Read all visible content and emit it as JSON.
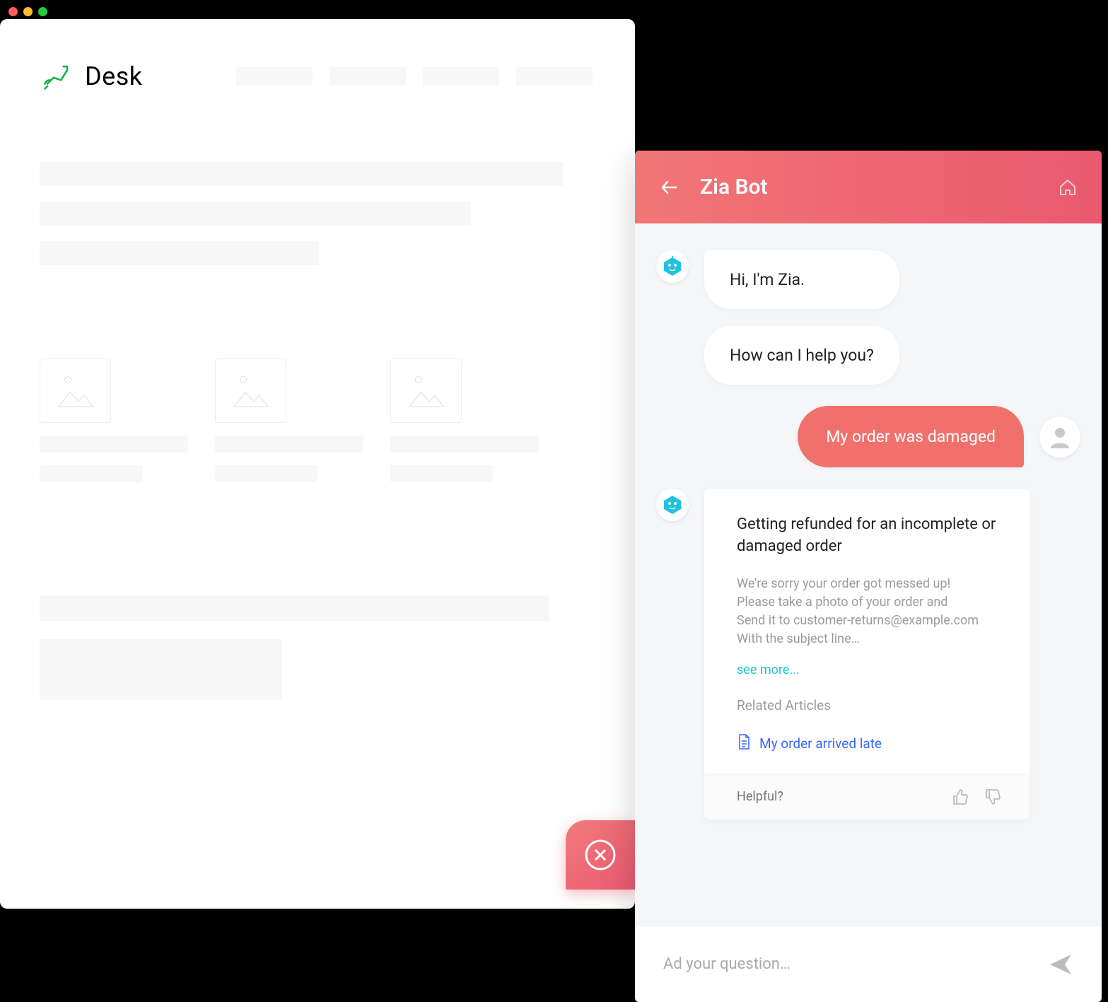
{
  "brand": {
    "name": "Desk"
  },
  "chat": {
    "title": "Zia Bot",
    "messages": {
      "bot_greeting_1": "Hi, I'm Zia.",
      "bot_greeting_2": "How can I help you?",
      "user_1": "My order was damaged"
    },
    "article": {
      "title": "Getting refunded for an incomplete or  damaged order",
      "body": "We're sorry your order got messed up!\nPlease take a photo of your order and\nSend it to customer-returns@example.com\nWith the subject line…",
      "see_more": "see more...",
      "related_label": "Related Articles",
      "related_link_1": "My order arrived late",
      "helpful_label": "Helpful?"
    },
    "composer": {
      "placeholder": "Ad your question…"
    }
  }
}
